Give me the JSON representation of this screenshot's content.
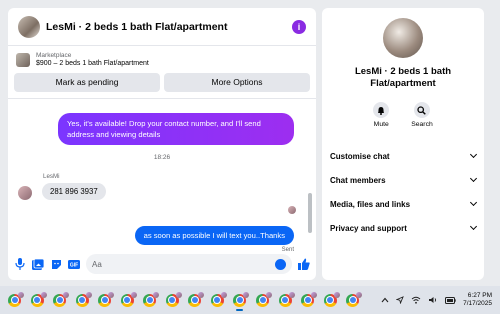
{
  "chat": {
    "title": "LesMi · 2 beds 1 bath Flat/apartment",
    "listing": {
      "source": "Marketplace",
      "name": "$900 – 2 beds 1 bath Flat/apartment"
    },
    "buttons": {
      "mark_pending": "Mark as pending",
      "more_options": "More Options"
    },
    "messages": {
      "outgoing_1": "Yes, it's available! Drop your contact number, and I'll send address and viewing details",
      "timestamp": "18:26",
      "sender": "LesMi",
      "incoming_1": "281 896 3937",
      "outgoing_2": "as soon as possible I will text you..Thanks",
      "status": "Sent"
    },
    "composer": {
      "placeholder": "Aa"
    }
  },
  "info_panel": {
    "name": "LesMi · 2 beds 1 bath Flat/apartment",
    "tools": {
      "mute": "Mute",
      "search": "Search"
    },
    "menu": [
      "Customise chat",
      "Chat members",
      "Media, files and links",
      "Privacy and support"
    ]
  },
  "taskbar": {
    "clock_time": "6:27 PM",
    "clock_date": "7/17/2025"
  },
  "colors": {
    "accent": "#0a66f5",
    "purple": "#8a2be2"
  }
}
